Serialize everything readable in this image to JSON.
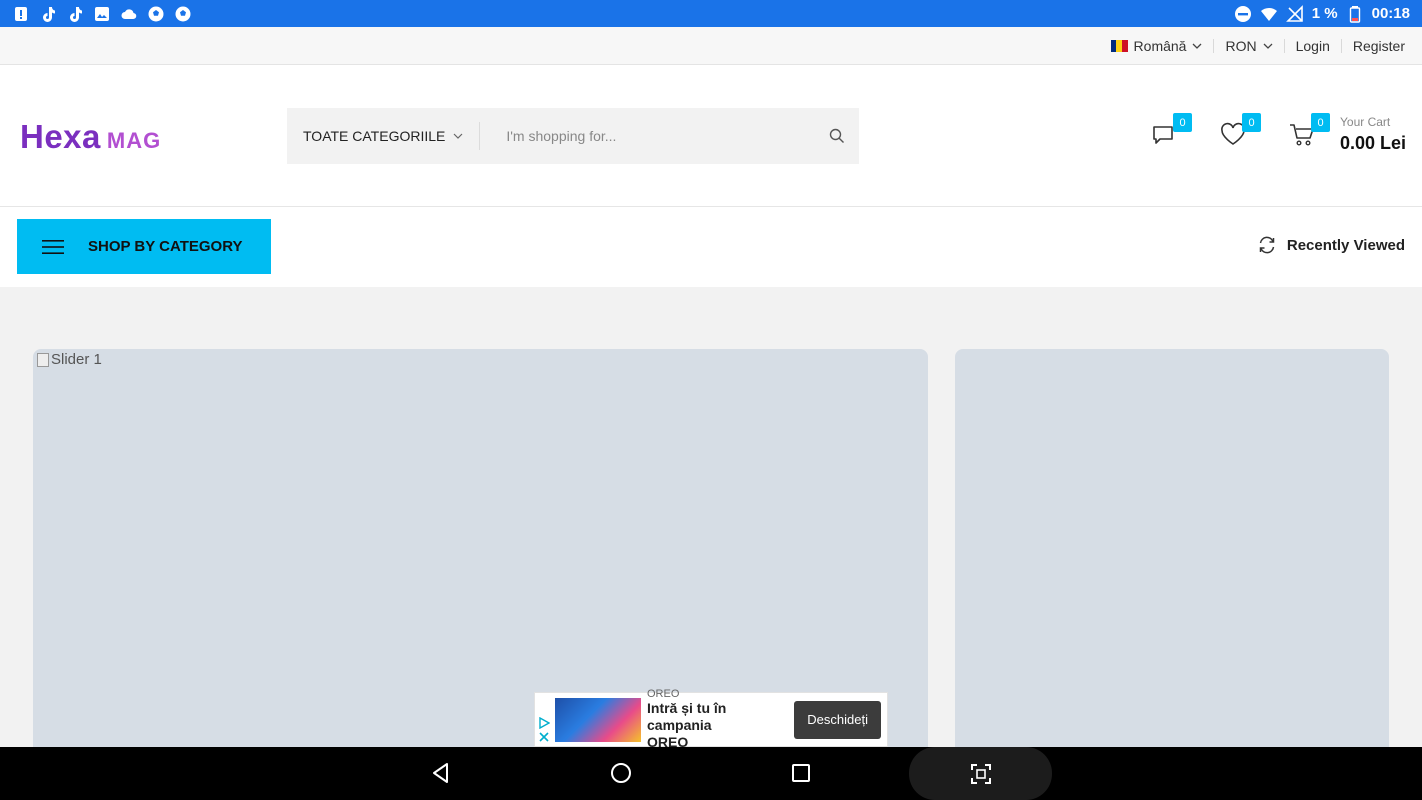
{
  "status_bar": {
    "battery_percent": "1 %",
    "time": "00:18",
    "colors": {
      "background": "#1a73e8"
    }
  },
  "topbar": {
    "language": "Română",
    "currency": "RON",
    "login": "Login",
    "register": "Register"
  },
  "header": {
    "logo_main": "Hexa",
    "logo_sub": "MAG",
    "category_select": "TOATE CATEGORIILE",
    "search_placeholder": "I'm shopping for...",
    "compare_count": "0",
    "wishlist_count": "0",
    "cart_count": "0",
    "cart_label": "Your Cart",
    "cart_total": "0.00 Lei"
  },
  "nav": {
    "shop_by_category": "SHOP BY CATEGORY",
    "recently_viewed": "Recently Viewed"
  },
  "main": {
    "slider_alt": "Slider 1"
  },
  "ad": {
    "brand": "OREO",
    "title_line1": "Intră și tu în campania",
    "title_line2": "OREO",
    "cta": "Deschideți"
  },
  "colors": {
    "accent": "#00bcf2",
    "logo_purple": "#7b2fbf",
    "placeholder_bg": "#d6dde5"
  }
}
